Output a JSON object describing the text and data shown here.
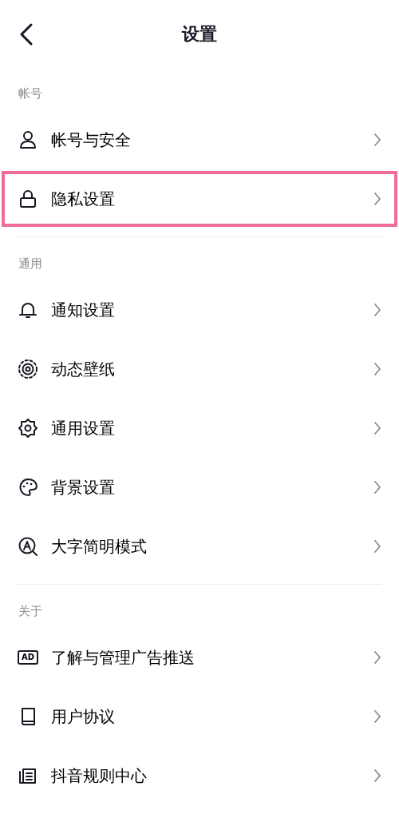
{
  "header": {
    "title": "设置"
  },
  "sections": [
    {
      "label": "帐号",
      "items": [
        {
          "kind": "person",
          "label": "帐号与安全",
          "highlighted": false
        },
        {
          "kind": "lock",
          "label": "隐私设置",
          "highlighted": true
        }
      ]
    },
    {
      "label": "通用",
      "items": [
        {
          "kind": "bell",
          "label": "通知设置",
          "highlighted": false
        },
        {
          "kind": "wallpaper",
          "label": "动态壁纸",
          "highlighted": false
        },
        {
          "kind": "gear",
          "label": "通用设置",
          "highlighted": false
        },
        {
          "kind": "palette",
          "label": "背景设置",
          "highlighted": false
        },
        {
          "kind": "font",
          "label": "大字简明模式",
          "highlighted": false
        }
      ]
    },
    {
      "label": "关于",
      "items": [
        {
          "kind": "ad",
          "icon_text": "AD",
          "label": "了解与管理广告推送",
          "highlighted": false
        },
        {
          "kind": "book",
          "label": "用户协议",
          "highlighted": false
        },
        {
          "kind": "doc",
          "label": "抖音规则中心",
          "highlighted": false
        }
      ]
    }
  ]
}
